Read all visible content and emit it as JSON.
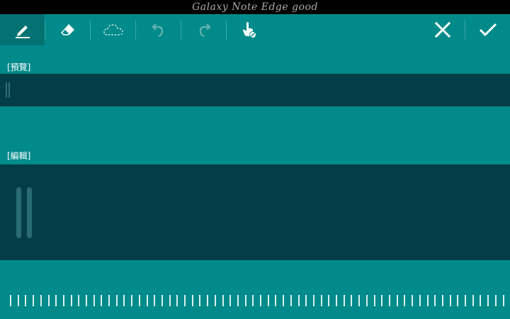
{
  "status_bar": {
    "title": "Galaxy Note Edge good"
  },
  "toolbar": {
    "tools": [
      {
        "name": "pen-tool",
        "icon": "pen-icon",
        "active": true
      },
      {
        "name": "eraser-tool",
        "icon": "eraser-icon",
        "active": false
      },
      {
        "name": "lasso-tool",
        "icon": "dashed-cloud-icon",
        "active": false
      },
      {
        "name": "undo-tool",
        "icon": "undo-icon",
        "active": false
      },
      {
        "name": "redo-tool",
        "icon": "redo-icon",
        "active": false
      },
      {
        "name": "touch-block-tool",
        "icon": "hand-block-icon",
        "active": false
      }
    ],
    "actions": [
      {
        "name": "cancel-button",
        "icon": "close-icon"
      },
      {
        "name": "confirm-button",
        "icon": "check-icon"
      }
    ]
  },
  "preview": {
    "label": "[預覽]"
  },
  "edit": {
    "label": "[編輯]"
  },
  "colors": {
    "background": "#018a8a",
    "dark_band": "#033d48",
    "active_tool": "#027272",
    "status_bar": "#000000"
  }
}
